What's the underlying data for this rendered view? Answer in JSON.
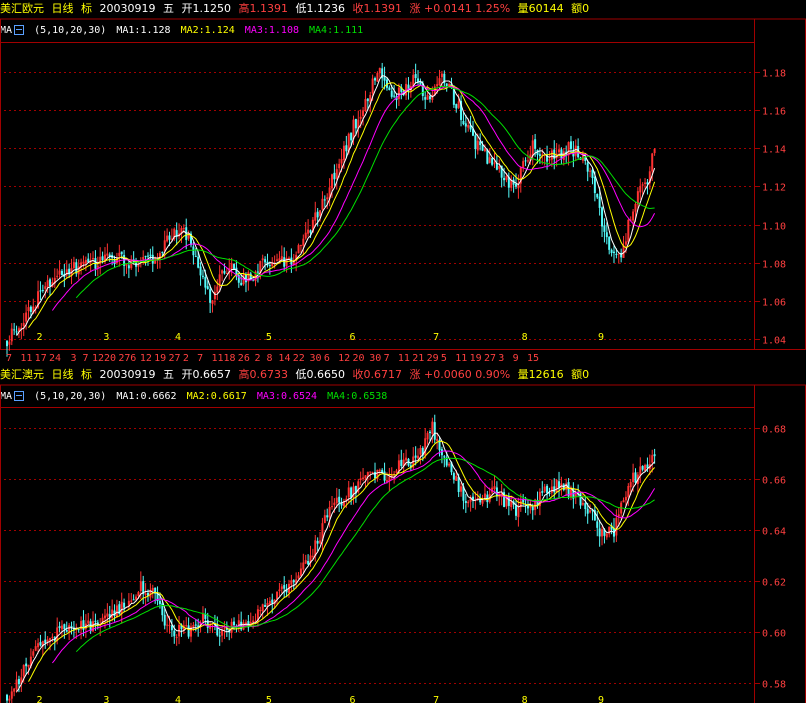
{
  "colors": {
    "up": "#ff3232",
    "down": "#54fcfc",
    "ma1": "#ffffff",
    "ma2": "#ffff00",
    "ma3": "#ff00ff",
    "ma4": "#00e000",
    "grid": "#a00000",
    "label": "#ff4040",
    "month": "#ffff00"
  },
  "chart_data": [
    {
      "type": "candlestick",
      "header": {
        "name": "美汇欧元",
        "period": "日线",
        "mark": "标",
        "date": "20030919",
        "weekday": "五",
        "open_label": "开1.1250",
        "high_label": "高1.1391",
        "low_label": "低1.1236",
        "close_label": "收1.1391",
        "change_label": "涨 +0.0141 1.25%",
        "volume_label": "量60144",
        "amount_label": "额0"
      },
      "ma_legend": {
        "name": "MA",
        "params": "(5,10,20,30)",
        "ma1": "MA1:1.128",
        "ma2": "MA2:1.124",
        "ma3": "MA3:1.108",
        "ma4": "MA4:1.111"
      },
      "ylim": [
        1.035,
        1.195
      ],
      "yticks": [
        "1.18",
        "1.16",
        "1.14",
        "1.12",
        "1.10",
        "1.08",
        "1.06",
        "1.04"
      ],
      "months": [
        "2",
        "3",
        "4",
        "5",
        "6",
        "7",
        "8",
        "9"
      ],
      "month_start_index": [
        14,
        42,
        72,
        110,
        145,
        180,
        217,
        249
      ],
      "day_labels": [
        "7",
        "11",
        "17",
        "24",
        "3",
        "7",
        "12",
        "20",
        "27",
        "6",
        "12",
        "19",
        "27",
        "2",
        "7",
        "11",
        "18",
        "26",
        "2",
        "8",
        "14",
        "22",
        "30",
        "6",
        "12",
        "20",
        "30",
        "7",
        "11",
        "21",
        "29",
        "5",
        "11",
        "19",
        "27",
        "3",
        "9",
        "15"
      ],
      "day_label_index": [
        0,
        6,
        12,
        18,
        27,
        32,
        36,
        41,
        47,
        52,
        56,
        62,
        68,
        74,
        80,
        86,
        91,
        97,
        104,
        109,
        114,
        120,
        127,
        133,
        139,
        145,
        152,
        158,
        164,
        170,
        176,
        182,
        188,
        194,
        200,
        206,
        212,
        218
      ],
      "anchors": [
        [
          0,
          1.04
        ],
        [
          12,
          1.06
        ],
        [
          22,
          1.075
        ],
        [
          30,
          1.078
        ],
        [
          45,
          1.083
        ],
        [
          52,
          1.078
        ],
        [
          60,
          1.08
        ],
        [
          70,
          1.098
        ],
        [
          75,
          1.095
        ],
        [
          80,
          1.078
        ],
        [
          85,
          1.062
        ],
        [
          92,
          1.078
        ],
        [
          100,
          1.07
        ],
        [
          108,
          1.082
        ],
        [
          118,
          1.08
        ],
        [
          128,
          1.1
        ],
        [
          138,
          1.13
        ],
        [
          148,
          1.16
        ],
        [
          155,
          1.18
        ],
        [
          162,
          1.168
        ],
        [
          170,
          1.175
        ],
        [
          176,
          1.165
        ],
        [
          182,
          1.178
        ],
        [
          190,
          1.158
        ],
        [
          198,
          1.138
        ],
        [
          205,
          1.13
        ],
        [
          212,
          1.118
        ],
        [
          220,
          1.142
        ],
        [
          228,
          1.135
        ],
        [
          236,
          1.14
        ],
        [
          244,
          1.13
        ],
        [
          250,
          1.095
        ],
        [
          256,
          1.082
        ],
        [
          262,
          1.108
        ],
        [
          268,
          1.125
        ],
        [
          271,
          1.14
        ]
      ]
    },
    {
      "type": "candlestick",
      "header": {
        "name": "美汇澳元",
        "period": "日线",
        "mark": "标",
        "date": "20030919",
        "weekday": "五",
        "open_label": "开0.6657",
        "high_label": "高0.6733",
        "low_label": "低0.6650",
        "close_label": "收0.6717",
        "change_label": "涨 +0.0060 0.90%",
        "volume_label": "量12616",
        "amount_label": "额0"
      },
      "ma_legend": {
        "name": "MA",
        "params": "(5,10,20,30)",
        "ma1": "MA1:0.6662",
        "ma2": "MA2:0.6617",
        "ma3": "MA3:0.6524",
        "ma4": "MA4:0.6538"
      },
      "ylim": [
        0.572,
        0.688
      ],
      "yticks": [
        "0.68",
        "0.66",
        "0.64",
        "0.62",
        "0.60",
        "0.58"
      ],
      "months": [
        "2",
        "3",
        "4",
        "5",
        "6",
        "7",
        "8",
        "9"
      ],
      "month_start_index": [
        14,
        42,
        72,
        110,
        145,
        180,
        217,
        249
      ],
      "anchors": [
        [
          0,
          0.575
        ],
        [
          12,
          0.592
        ],
        [
          22,
          0.6
        ],
        [
          32,
          0.602
        ],
        [
          40,
          0.605
        ],
        [
          48,
          0.61
        ],
        [
          56,
          0.618
        ],
        [
          62,
          0.615
        ],
        [
          68,
          0.6
        ],
        [
          75,
          0.6
        ],
        [
          82,
          0.605
        ],
        [
          90,
          0.6
        ],
        [
          95,
          0.602
        ],
        [
          102,
          0.605
        ],
        [
          110,
          0.612
        ],
        [
          120,
          0.618
        ],
        [
          128,
          0.632
        ],
        [
          136,
          0.65
        ],
        [
          144,
          0.655
        ],
        [
          150,
          0.66
        ],
        [
          158,
          0.662
        ],
        [
          165,
          0.665
        ],
        [
          172,
          0.668
        ],
        [
          178,
          0.68
        ],
        [
          183,
          0.668
        ],
        [
          190,
          0.655
        ],
        [
          196,
          0.65
        ],
        [
          204,
          0.655
        ],
        [
          212,
          0.648
        ],
        [
          220,
          0.65
        ],
        [
          228,
          0.658
        ],
        [
          236,
          0.655
        ],
        [
          242,
          0.65
        ],
        [
          248,
          0.64
        ],
        [
          254,
          0.64
        ],
        [
          260,
          0.658
        ],
        [
          266,
          0.663
        ],
        [
          271,
          0.67
        ]
      ]
    }
  ]
}
